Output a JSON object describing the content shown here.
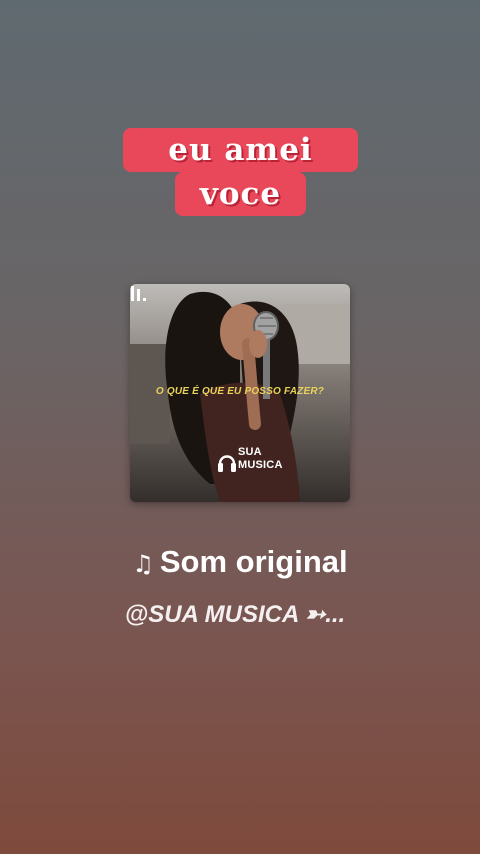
{
  "sticker": {
    "line1": "eu amei",
    "line2": "voce"
  },
  "cover": {
    "lyric": "O QUE É QUE EU POSSO FAZER?",
    "brand_line1": "SUA",
    "brand_line2": "MUSICA",
    "bars_icon": "audio-bars-icon"
  },
  "sound": {
    "note_icon": "♫",
    "title": "Som original",
    "author": "@SUA MUSICA ➳..."
  },
  "colors": {
    "sticker_bg": "#e9485a",
    "lyric": "#e8d25a"
  }
}
